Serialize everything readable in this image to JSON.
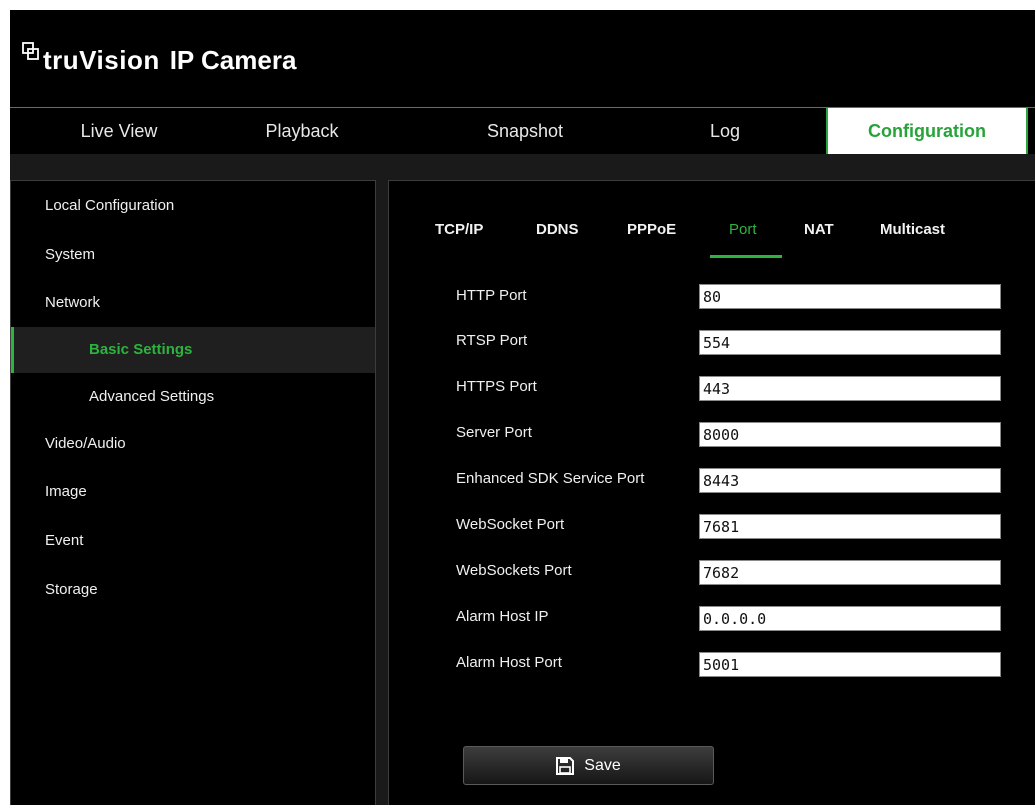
{
  "header": {
    "brand": "truVision",
    "product": "IP Camera",
    "logo_icon": "truvision-logo-icon"
  },
  "nav": {
    "items": [
      {
        "label": "Live View"
      },
      {
        "label": "Playback"
      },
      {
        "label": "Snapshot"
      },
      {
        "label": "Log"
      },
      {
        "label": "Configuration",
        "active": true
      }
    ]
  },
  "sidebar": {
    "items": [
      {
        "label": "Local Configuration"
      },
      {
        "label": "System"
      },
      {
        "label": "Network"
      },
      {
        "label": "Basic Settings",
        "active": true
      },
      {
        "label": "Advanced Settings"
      },
      {
        "label": "Video/Audio"
      },
      {
        "label": "Image"
      },
      {
        "label": "Event"
      },
      {
        "label": "Storage"
      }
    ]
  },
  "tabs": [
    {
      "label": "TCP/IP"
    },
    {
      "label": "DDNS"
    },
    {
      "label": "PPPoE"
    },
    {
      "label": "Port",
      "active": true
    },
    {
      "label": "NAT"
    },
    {
      "label": "Multicast"
    }
  ],
  "form": {
    "fields": [
      {
        "label": "HTTP Port",
        "value": "80"
      },
      {
        "label": "RTSP Port",
        "value": "554"
      },
      {
        "label": "HTTPS Port",
        "value": "443"
      },
      {
        "label": "Server Port",
        "value": "8000"
      },
      {
        "label": "Enhanced SDK Service Port",
        "value": "8443"
      },
      {
        "label": "WebSocket Port",
        "value": "7681"
      },
      {
        "label": "WebSockets Port",
        "value": "7682"
      },
      {
        "label": "Alarm Host IP",
        "value": "0.0.0.0"
      },
      {
        "label": "Alarm Host Port",
        "value": "5001"
      }
    ],
    "save_label": "Save",
    "save_icon": "floppy-disk-icon"
  },
  "colors": {
    "accent": "#2db33f",
    "background": "#000000"
  }
}
